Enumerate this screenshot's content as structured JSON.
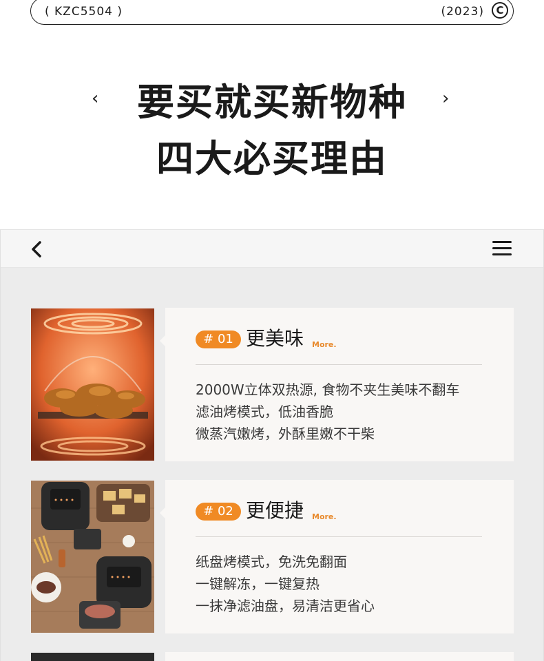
{
  "top_bar": {
    "model_code": "( KZC5504 )",
    "year": "(2023)",
    "copyright_glyph": "C"
  },
  "headline": {
    "line1": "要买就买新物种",
    "line2": "四大必买理由",
    "prev_arrow": "‹",
    "next_arrow": "›"
  },
  "phone_nav": {
    "back_icon": "chevron-left-icon",
    "menu_icon": "hamburger-menu-icon"
  },
  "features": [
    {
      "badge": "# 01",
      "title": "更美味",
      "more": "More.",
      "lines": [
        "2000W立体双热源, 食物不夹生美味不翻车",
        "滤油烤模式，低油香脆",
        "微蒸汽嫩烤，外酥里嫩不干柴"
      ]
    },
    {
      "badge": "# 02",
      "title": "更便捷",
      "more": "More.",
      "lines": [
        "纸盘烤模式，免洗免翻面",
        "一键解冻，一键复热",
        "一抹净滤油盘，易清洁更省心"
      ]
    }
  ],
  "colors": {
    "accent_orange": "#f08a24",
    "more_orange": "#e8892b",
    "card_bg": "#f9f7f5",
    "phone_bg": "#ececec"
  }
}
